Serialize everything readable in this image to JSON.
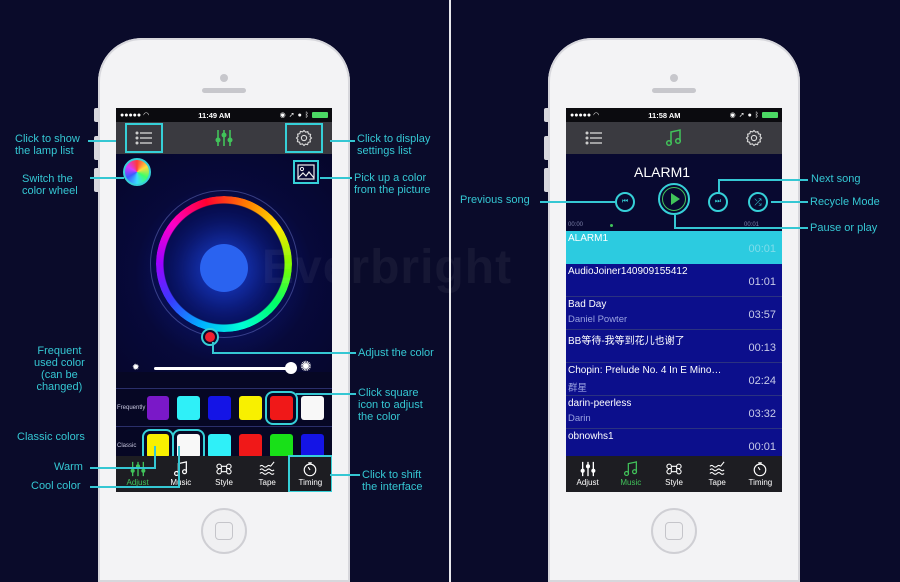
{
  "left_phone": {
    "status": {
      "carrier": "●●●●●",
      "time": "11:49 AM"
    },
    "topbar": {
      "left_icon": "list-icon",
      "center_icon": "sliders-icon",
      "right_icon": "gear-icon"
    },
    "color_wheel": {
      "selected_color": "#2a63f0",
      "brightness_percent": 90
    },
    "frequently": {
      "label": "Frequently",
      "colors": [
        "#7a18c8",
        "#2ff0f8",
        "#1414e6",
        "#f8f000",
        "#f01818",
        "#f8f8f8"
      ]
    },
    "classic": {
      "label": "Classic",
      "colors": [
        "#f8f000",
        "#f8f8f8",
        "#2ff0f8",
        "#f01818",
        "#18e018",
        "#1414e6"
      ]
    },
    "tabs": [
      {
        "label": "Adjust",
        "icon": "sliders-icon",
        "active": true
      },
      {
        "label": "Music",
        "icon": "music-note-icon",
        "active": false
      },
      {
        "label": "Style",
        "icon": "command-icon",
        "active": false
      },
      {
        "label": "Tape",
        "icon": "waves-icon",
        "active": false
      },
      {
        "label": "Timing",
        "icon": "stopwatch-icon",
        "active": false
      }
    ]
  },
  "left_annotations": {
    "lamp_list": "Click to show\nthe lamp list",
    "color_wheel": "Switch the\ncolor wheel",
    "frequent": "Frequent\nused color\n(can be\nchanged)",
    "classic": "Classic colors",
    "warm": "Warm",
    "cool": "Cool color",
    "settings": "Click to display\nsettings list",
    "picture": "Pick up a color\nfrom the picture",
    "adjust": "Adjust the color",
    "square": "Click square\nicon to adjust\nthe color",
    "shift": "Click to shift\nthe interface"
  },
  "right_phone": {
    "status": {
      "carrier": "●●●●●",
      "time": "11:58 AM"
    },
    "now_playing": "ALARM1",
    "elapsed": "00:00",
    "total": "00:01",
    "songs": [
      {
        "title": "ALARM1",
        "artist": "",
        "duration": "00:01",
        "selected": true
      },
      {
        "title": "AudioJoiner140909155412",
        "artist": "",
        "duration": "01:01"
      },
      {
        "title": "Bad Day",
        "artist": "Daniel Powter",
        "duration": "03:57"
      },
      {
        "title": "BB等待-我等到花儿也谢了",
        "artist": "",
        "duration": "00:13"
      },
      {
        "title": "Chopin: Prelude No. 4 In E Mino…",
        "artist": "群星",
        "duration": "02:24"
      },
      {
        "title": "darin-peerless",
        "artist": "Darin",
        "duration": "03:32"
      },
      {
        "title": "obnowhs1",
        "artist": "",
        "duration": "00:01"
      }
    ],
    "tabs": [
      {
        "label": "Adjust",
        "icon": "sliders-icon",
        "active": false
      },
      {
        "label": "Music",
        "icon": "music-note-icon",
        "active": true
      },
      {
        "label": "Style",
        "icon": "command-icon",
        "active": false
      },
      {
        "label": "Tape",
        "icon": "waves-icon",
        "active": false
      },
      {
        "label": "Timing",
        "icon": "stopwatch-icon",
        "active": false
      }
    ]
  },
  "right_annotations": {
    "previous": "Previous song",
    "next": "Next song",
    "recycle": "Recycle Mode",
    "pause": "Pause or play"
  },
  "watermark": "Everbright"
}
